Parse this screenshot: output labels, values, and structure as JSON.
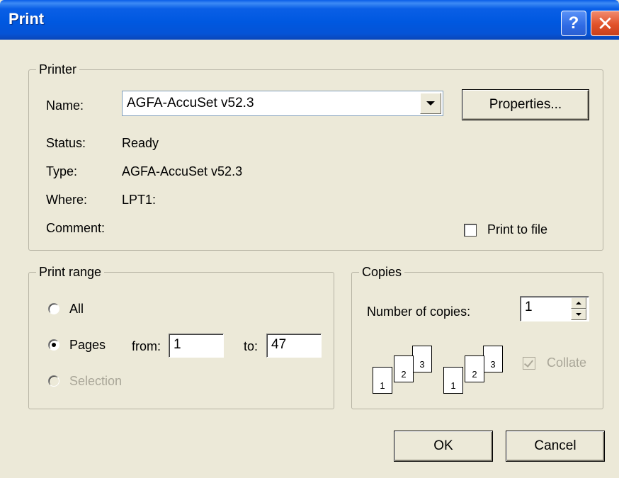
{
  "window": {
    "title": "Print"
  },
  "printer": {
    "legend": "Printer",
    "name_label": "Name:",
    "name_value": "AGFA-AccuSet v52.3",
    "properties_button": "Properties...",
    "status_label": "Status:",
    "status_value": "Ready",
    "type_label": "Type:",
    "type_value": "AGFA-AccuSet v52.3",
    "where_label": "Where:",
    "where_value": "LPT1:",
    "comment_label": "Comment:",
    "print_to_file_label": "Print to file"
  },
  "print_range": {
    "legend": "Print range",
    "all_label": "All",
    "pages_label": "Pages",
    "from_label": "from:",
    "from_value": "1",
    "to_label": "to:",
    "to_value": "47",
    "selection_label": "Selection"
  },
  "copies": {
    "legend": "Copies",
    "number_label": "Number of copies:",
    "number_value": "1",
    "collate_label": "Collate",
    "collate_pages": [
      "1",
      "2",
      "3"
    ]
  },
  "buttons": {
    "ok": "OK",
    "cancel": "Cancel"
  },
  "colors": {
    "titlebar": "#0058e0",
    "face": "#ece9d8",
    "close": "#e2522a"
  }
}
